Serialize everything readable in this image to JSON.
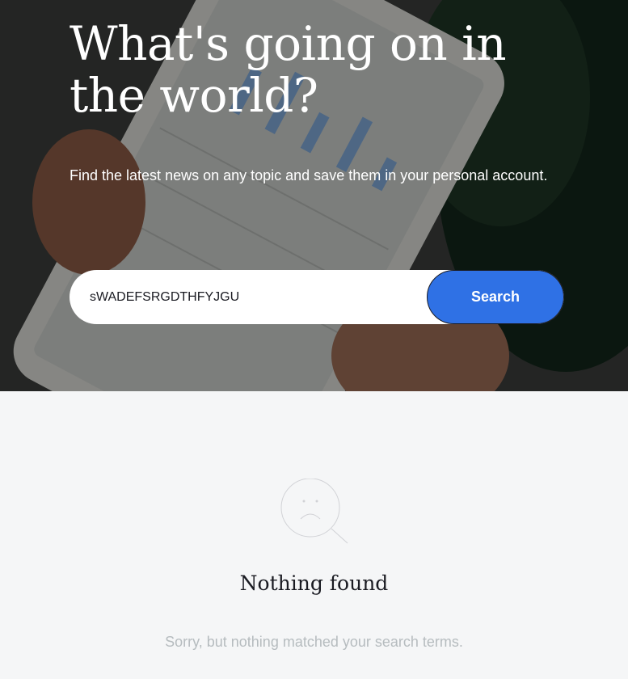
{
  "hero": {
    "title": "What's going on in the world?",
    "subtitle": "Find the latest news on any topic and save them in your personal account."
  },
  "search": {
    "value": "sWADEFSRGDTHFYJGU",
    "button_label": "Search"
  },
  "results": {
    "icon": "sad-face-magnifier-icon",
    "title": "Nothing found",
    "message": "Sorry, but nothing matched your search terms."
  },
  "colors": {
    "accent": "#2f71e5",
    "background": "#f5f6f7",
    "muted_text": "#b6bcbf",
    "dark_text": "#1a1b22"
  }
}
